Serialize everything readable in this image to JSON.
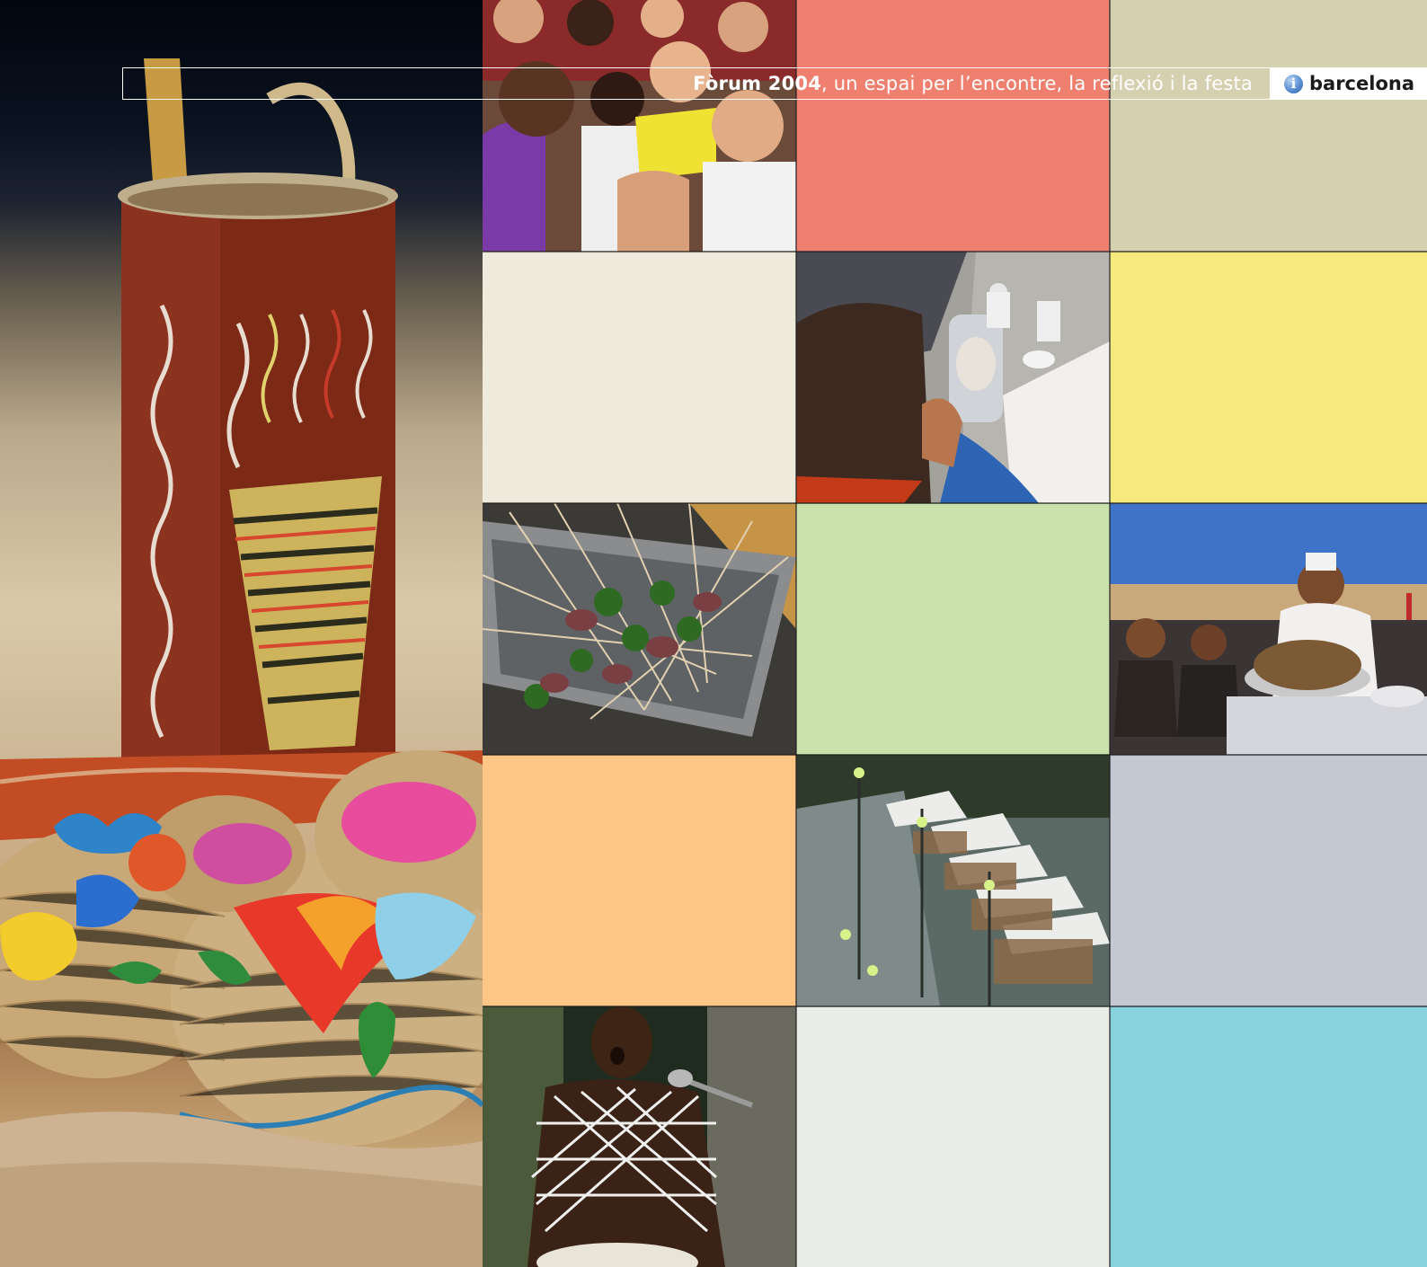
{
  "header": {
    "title_bold": "Fòrum 2004",
    "title_rest": ", un espai per l’encontre, la reflexió i la festa",
    "brand_label": "barcelona",
    "brand_icon": "info-icon"
  },
  "colors": {
    "tile_salmon": "#ef8070",
    "tile_khaki": "#d5d0b0",
    "tile_cream": "#eeebdc",
    "tile_yellow": "#f6ea7e",
    "tile_green": "#cbe1ac",
    "tile_orange": "#ffc685",
    "tile_gray": "#c4c8d2",
    "tile_mint": "#e8ede8",
    "tile_cyan": "#88d2dd"
  },
  "photos": [
    "children-audience-photo",
    "mime-mirror-photo",
    "skewers-photo",
    "market-vendor-photo",
    "rambla-cafe-photo",
    "drummer-singer-photo"
  ]
}
